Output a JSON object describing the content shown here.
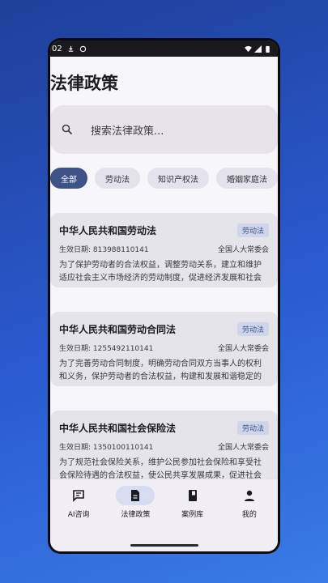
{
  "status": {
    "time": "02"
  },
  "title": "法律政策",
  "search": {
    "placeholder": "搜索法律政策..."
  },
  "chips": [
    "全部",
    "劳动法",
    "知识产权法",
    "婚姻家庭法"
  ],
  "active_chip": "全部",
  "cards": [
    {
      "title": "中华人民共和国劳动法",
      "tag": "劳动法",
      "date": "生效日期: 813988110141",
      "issuer": "全国人大常委会",
      "desc": "为了保护劳动者的合法权益，调整劳动关系，建立和维护适应社会主义市场经济的劳动制度，促进经济发展和社会进步，根据宪法，制定本法。本法适用于..."
    },
    {
      "title": "中华人民共和国劳动合同法",
      "tag": "劳动法",
      "date": "生效日期: 1255492110141",
      "issuer": "全国人大常委会",
      "desc": "为了完善劳动合同制度，明确劳动合同双方当事人的权利和义务，保护劳动者的合法权益，构建和发展和谐稳定的劳动关系，制定本法。用人单位与劳动者..."
    },
    {
      "title": "中华人民共和国社会保险法",
      "tag": "劳动法",
      "date": "生效日期: 1350100110141",
      "issuer": "全国人大常委会",
      "desc": "为了规范社会保险关系，维护公民参加社会保险和享受社会保险待遇的合法权益，使公民共享发展成果，促进社会和谐稳定，根据宪法，制定本法。国家建..."
    }
  ],
  "nav": [
    {
      "label": "AI咨询",
      "icon": "chat-icon"
    },
    {
      "label": "法律政策",
      "icon": "document-icon",
      "active": true
    },
    {
      "label": "案例库",
      "icon": "book-icon"
    },
    {
      "label": "我的",
      "icon": "person-icon"
    }
  ],
  "colors": {
    "accent": "#3f5287",
    "card": "#e6e4eb",
    "background": "#1f3f9a"
  }
}
